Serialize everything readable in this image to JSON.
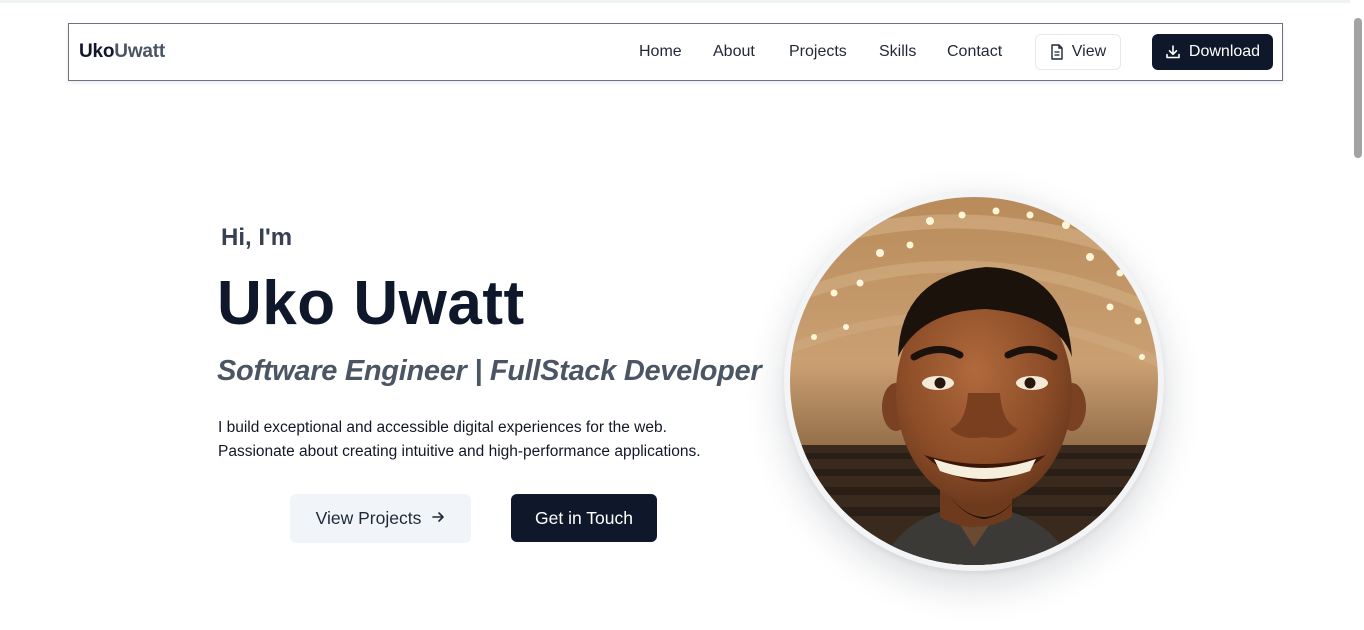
{
  "brand": {
    "first": "Uko",
    "second": "Uwatt"
  },
  "nav": {
    "links": [
      "Home",
      "About",
      "Projects",
      "Skills",
      "Contact"
    ],
    "view_label": "View",
    "download_label": "Download"
  },
  "hero": {
    "greeting": "Hi, I'm",
    "name": "Uko Uwatt",
    "role": "Software Engineer | FullStack Developer",
    "description_line1": "I build exceptional and accessible digital experiences for the web.",
    "description_line2": "Passionate about creating intuitive and high-performance applications.",
    "primary_button": "View Projects",
    "secondary_button": "Get in Touch"
  },
  "icons": {
    "view": "document-icon",
    "download": "download-icon",
    "arrow": "arrow-right-icon"
  },
  "colors": {
    "primary": "#0f172a",
    "muted_text": "#4b5563",
    "secondary_button_bg": "#f1f5f9"
  }
}
